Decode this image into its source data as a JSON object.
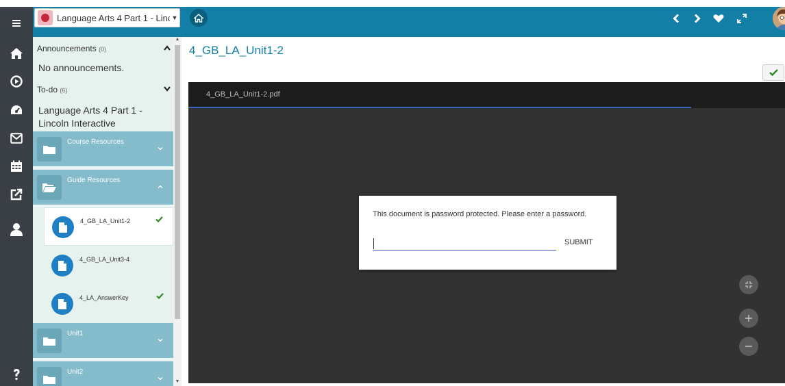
{
  "course": {
    "name": "Language Arts 4 Part 1 - Linc..."
  },
  "sidebar": {
    "announcements": {
      "label": "Announcements",
      "count": "(0)",
      "empty_text": "No announcements."
    },
    "todo": {
      "label": "To-do",
      "count": "(6)"
    },
    "course_title": "Language Arts 4 Part 1 - Lincoln Interactive",
    "folders": [
      {
        "label": "Course Resources",
        "expanded": false
      },
      {
        "label": "Guide Resources",
        "expanded": true
      },
      {
        "label": "Unit1",
        "expanded": false
      },
      {
        "label": "Unit2",
        "expanded": false
      }
    ],
    "items": [
      {
        "label": "4_GB_LA_Unit1-2",
        "completed": true,
        "active": true
      },
      {
        "label": "4_GB_LA_Unit3-4",
        "completed": false,
        "active": false
      },
      {
        "label": "4_LA_AnswerKey",
        "completed": true,
        "active": false
      }
    ]
  },
  "main": {
    "title": "4_GB_LA_Unit1-2",
    "viewer": {
      "tab_label": "4_GB_LA_Unit1-2.pdf",
      "dialog": {
        "message": "This document is password protected. Please enter a password.",
        "password_value": "",
        "submit_label": "SUBMIT"
      }
    }
  },
  "colors": {
    "topbar": "#137fa6",
    "rail": "#3a3f45",
    "sidebar": "#e6f2ee",
    "folder": "#84bccc",
    "check": "#2e8b22",
    "viewer": "#323232"
  },
  "icons": {
    "rail": [
      "menu-icon",
      "home-icon",
      "play-icon",
      "dashboard-icon",
      "mail-icon",
      "calendar-icon",
      "external-link-icon",
      "user-icon",
      "help-icon"
    ],
    "topbar": [
      "home-icon",
      "chevron-left-icon",
      "chevron-right-icon",
      "heart-icon",
      "expand-icon"
    ]
  }
}
